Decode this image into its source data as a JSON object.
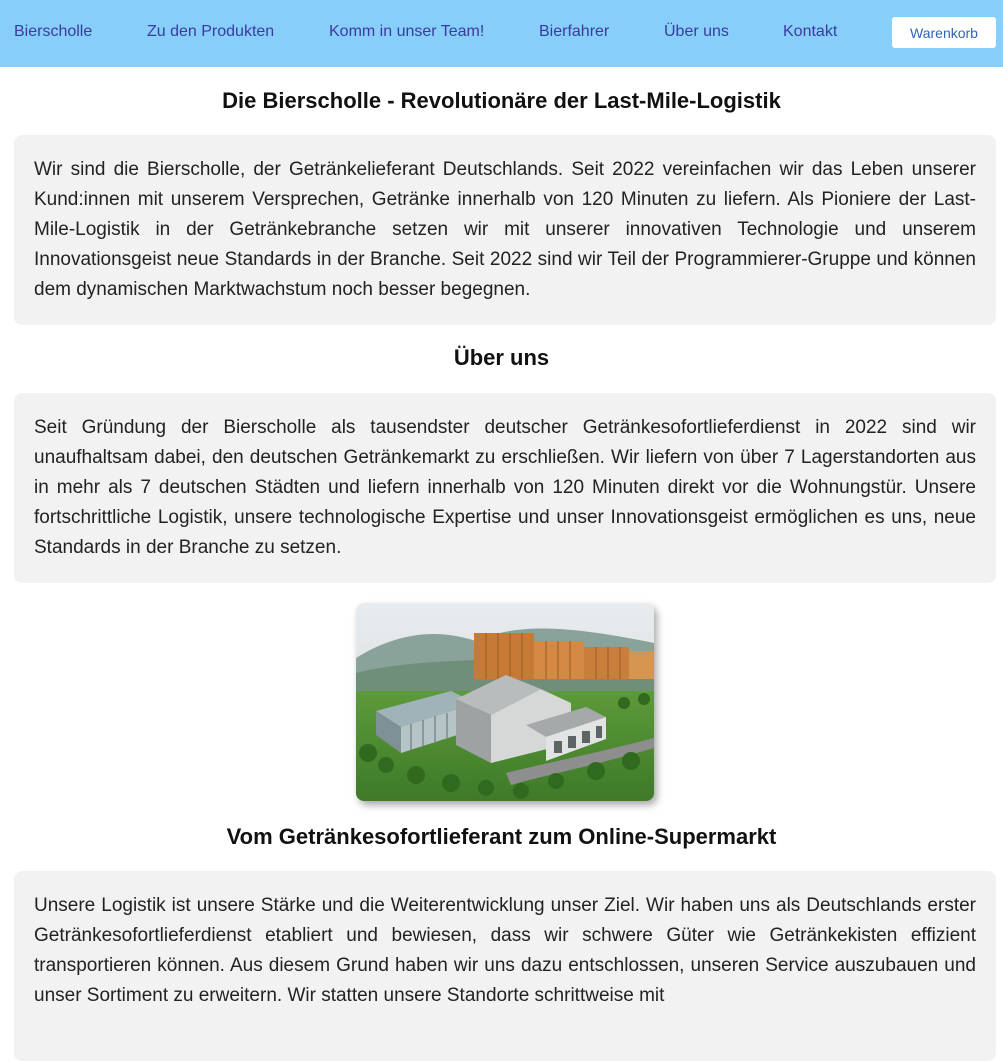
{
  "nav": {
    "brand": "Bierscholle",
    "items": [
      "Zu den Produkten",
      "Komm in unser Team!",
      "Bierfahrer",
      "Über uns",
      "Kontakt"
    ],
    "cart_label": "Warenkorb"
  },
  "sections": {
    "intro": {
      "title": "Die Bierscholle - Revolutionäre der Last-Mile-Logistik",
      "text": "Wir sind die Bierscholle, der Getränkelieferant Deutschlands. Seit 2022 vereinfachen wir das Leben unserer Kund:innen mit unserem Versprechen, Getränke innerhalb von 120 Minuten zu liefern. Als Pioniere der Last-Mile-Logistik in der Getränkebranche setzen wir mit unserer innovativen Technologie und unserem Innovationsgeist neue Standards in der Branche. Seit 2022 sind wir Teil der Programmierer-Gruppe und können dem dynamischen Marktwachstum noch besser begegnen."
    },
    "about": {
      "title": "Über uns",
      "text": "Seit Gründung der Bierscholle als tausendster deutscher Getränkesofortlieferdienst in 2022 sind wir unaufhaltsam dabei, den deutschen Getränkemarkt zu erschließen. Wir liefern von über 7 Lagerstandorten aus in mehr als 7 deutschen Städten und liefern innerhalb von 120 Minuten direkt vor die Wohnungstür. Unsere fortschrittliche Logistik, unsere technologische Expertise und unser Innovationsgeist ermöglichen es uns, neue Standards in der Branche zu setzen."
    },
    "supermarket": {
      "title": "Vom Getränkesofortlieferant zum Online-Supermarkt",
      "text": "Unsere Logistik ist unsere Stärke und die Weiterentwicklung unser Ziel. Wir haben uns als Deutschlands erster Getränkesofortlieferdienst etabliert und bewiesen, dass wir schwere Güter wie Getränkekisten effizient transportieren können. Aus diesem Grund haben wir uns dazu entschlossen, unseren Service auszubauen und unser Sortiment zu erweitern. Wir statten unsere Standorte schrittweise mit"
    }
  },
  "colors": {
    "nav_background": "#87cefa",
    "nav_link": "#3b3b9e",
    "panel_background": "#f2f2f2",
    "cart_text": "#2f64b5"
  }
}
